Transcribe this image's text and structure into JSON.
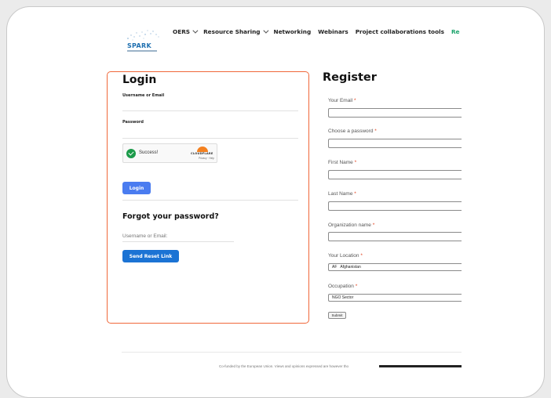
{
  "header": {
    "logo_text": "SPARK",
    "nav": [
      {
        "label": "OERS",
        "dropdown": true
      },
      {
        "label": "Resource Sharing",
        "dropdown": true
      },
      {
        "label": "Networking",
        "dropdown": false
      },
      {
        "label": "Webinars",
        "dropdown": false
      },
      {
        "label": "Project collaborations tools",
        "dropdown": false
      },
      {
        "label": "Registr",
        "dropdown": false
      }
    ]
  },
  "login": {
    "title": "Login",
    "username_label": "Username or Email",
    "password_label": "Password",
    "captcha_status": "Success!",
    "captcha_brand": "CLOUDFLARE",
    "captcha_links": "Privacy · Help",
    "login_button": "Login",
    "forgot_title": "Forgot your password?",
    "forgot_placeholder": "Username or Email:",
    "reset_button": "Send Reset Link"
  },
  "register": {
    "title": "Register",
    "fields": [
      {
        "label": "Your Email",
        "required": "*"
      },
      {
        "label": "Choose a password",
        "required": "*"
      },
      {
        "label": "First Name",
        "required": "*"
      },
      {
        "label": "Last Name",
        "required": "*"
      },
      {
        "label": "Organization name",
        "required": "*"
      }
    ],
    "location_label": "Your Location",
    "location_required": "*",
    "location_value": "Afghanistan",
    "location_code": "AF",
    "occupation_label": "Occupation",
    "occupation_required": "*",
    "occupation_value": "NGO Sector",
    "submit_button": "Submit"
  },
  "footer": {
    "text": "Co-funded by the European Union. Views and opinions expressed are however tho"
  },
  "colors": {
    "accent_login_border": "#f0683a",
    "login_button": "#4a7cf0",
    "reset_button": "#1b73d4",
    "nav_active": "#1aa36b",
    "required": "#e2401c"
  }
}
